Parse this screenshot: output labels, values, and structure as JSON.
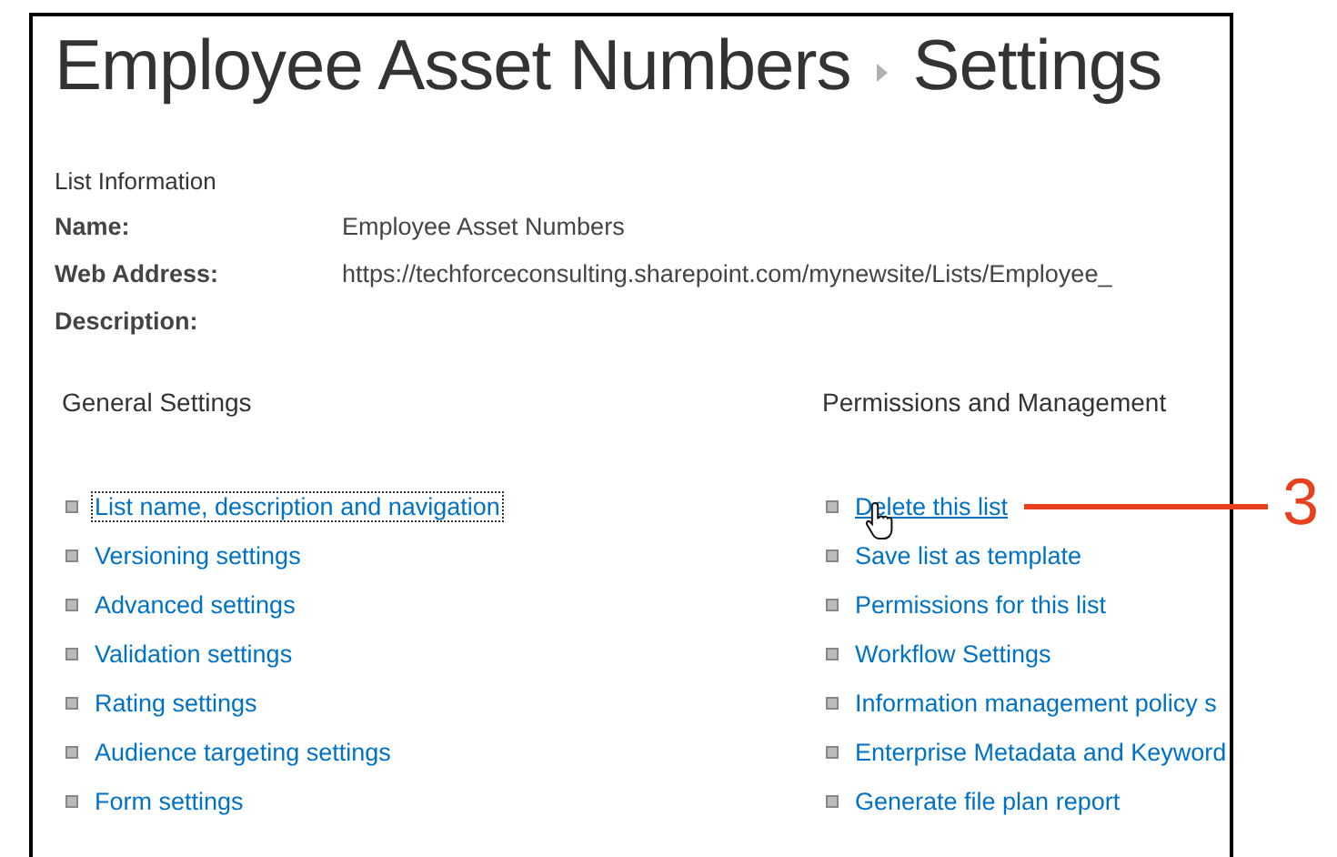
{
  "page": {
    "title": "Employee Asset Numbers",
    "breadcrumb_current": "Settings"
  },
  "list_information": {
    "heading": "List Information",
    "fields": [
      {
        "label": "Name:",
        "value": "Employee Asset Numbers"
      },
      {
        "label": "Web Address:",
        "value": "https://techforceconsulting.sharepoint.com/mynewsite/Lists/Employee_"
      },
      {
        "label": "Description:"
      }
    ]
  },
  "sections": [
    {
      "heading": "General Settings",
      "links": [
        {
          "label": "List name, description and navigation",
          "focused": true,
          "hovered": false
        },
        {
          "label": "Versioning settings",
          "focused": false,
          "hovered": false
        },
        {
          "label": "Advanced settings",
          "focused": false,
          "hovered": false
        },
        {
          "label": "Validation settings",
          "focused": false,
          "hovered": false
        },
        {
          "label": "Rating settings",
          "focused": false,
          "hovered": false
        },
        {
          "label": "Audience targeting settings",
          "focused": false,
          "hovered": false
        },
        {
          "label": "Form settings",
          "focused": false,
          "hovered": false
        }
      ]
    },
    {
      "heading": "Permissions and Management",
      "links": [
        {
          "label": "Delete this list",
          "focused": false,
          "hovered": true
        },
        {
          "label": "Save list as template",
          "focused": false,
          "hovered": false
        },
        {
          "label": "Permissions for this list",
          "focused": false,
          "hovered": false
        },
        {
          "label": "Workflow Settings",
          "focused": false,
          "hovered": false
        },
        {
          "label": "Information management policy s",
          "focused": false,
          "hovered": false
        },
        {
          "label": "Enterprise Metadata and Keyword",
          "focused": false,
          "hovered": false
        },
        {
          "label": "Generate file plan report",
          "focused": false,
          "hovered": false
        }
      ]
    }
  ],
  "callout": {
    "label": "3"
  }
}
